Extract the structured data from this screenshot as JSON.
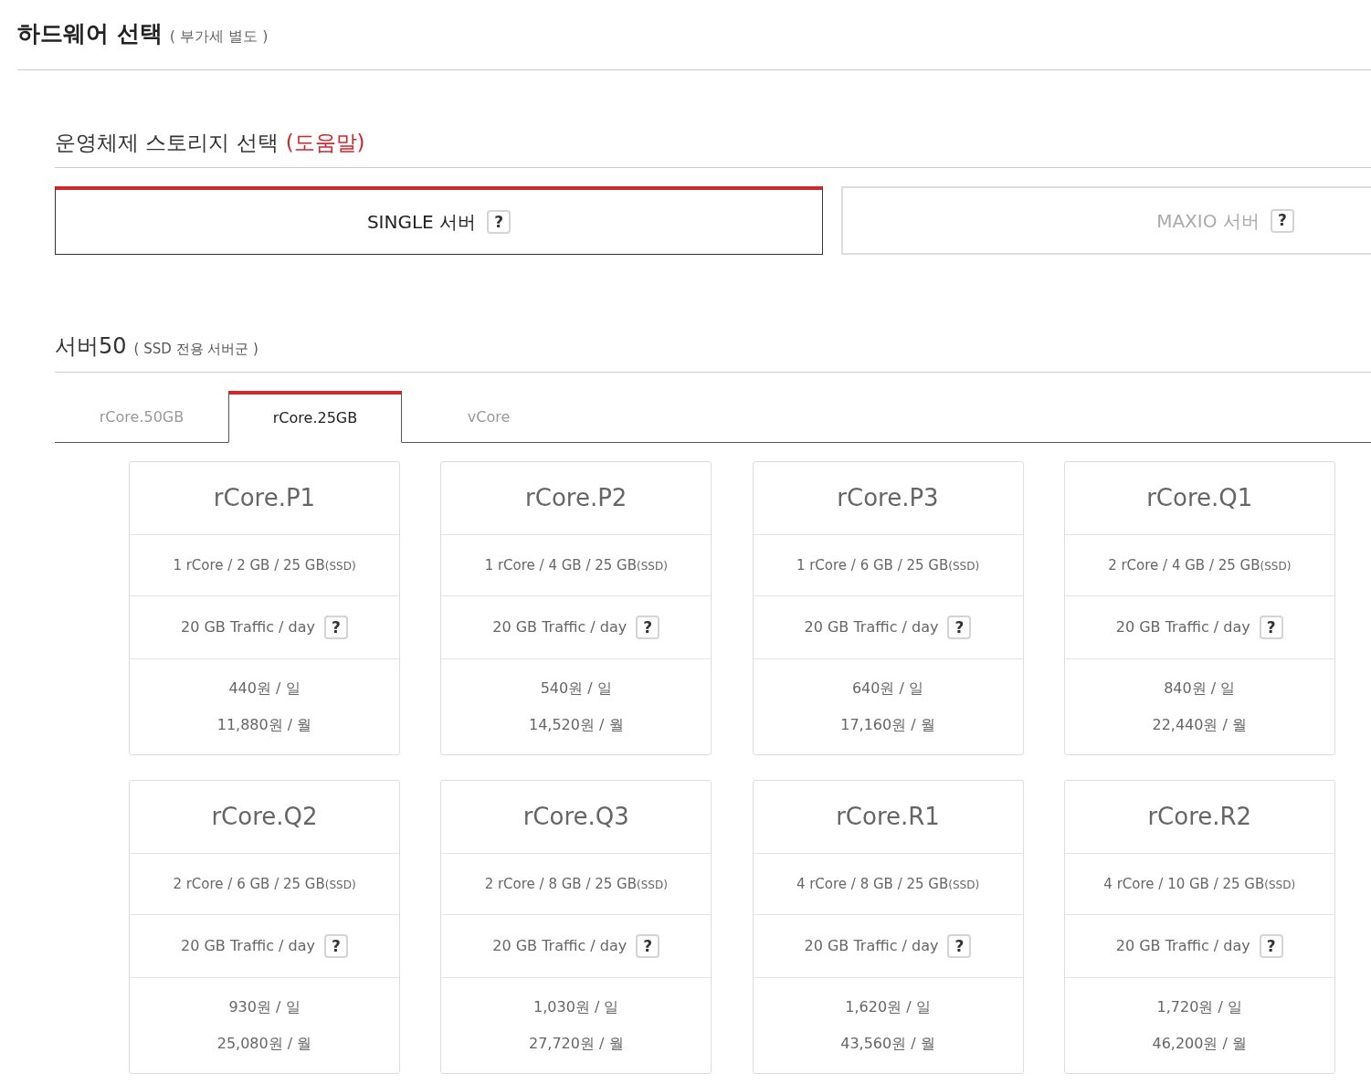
{
  "header": {
    "title": "하드웨어 선택",
    "note": "( 부가세 별도 )"
  },
  "os_section": {
    "title": "운영체제 스토리지 선택",
    "help_link": "(도움말)"
  },
  "server_types": [
    {
      "label": "SINGLE 서버",
      "help": "?",
      "selected": true
    },
    {
      "label": "MAXIO 서버",
      "help": "?",
      "selected": false
    }
  ],
  "group": {
    "title": "서버50",
    "note": "( SSD 전용 서버군 )"
  },
  "tabs": [
    {
      "label": "rCore.50GB",
      "selected": false
    },
    {
      "label": "rCore.25GB",
      "selected": true
    },
    {
      "label": "vCore",
      "selected": false
    }
  ],
  "plans": [
    {
      "name": "rCore.P1",
      "spec": "1 rCore / 2 GB / 25 GB",
      "spec_note": "(SSD)",
      "traffic": "20 GB Traffic / day",
      "help": "?",
      "daily": "440원 / 일",
      "monthly": "11,880원 / 월"
    },
    {
      "name": "rCore.P2",
      "spec": "1 rCore / 4 GB / 25 GB",
      "spec_note": "(SSD)",
      "traffic": "20 GB Traffic / day",
      "help": "?",
      "daily": "540원 / 일",
      "monthly": "14,520원 / 월"
    },
    {
      "name": "rCore.P3",
      "spec": "1 rCore / 6 GB / 25 GB",
      "spec_note": "(SSD)",
      "traffic": "20 GB Traffic / day",
      "help": "?",
      "daily": "640원 / 일",
      "monthly": "17,160원 / 월"
    },
    {
      "name": "rCore.Q1",
      "spec": "2 rCore / 4 GB / 25 GB",
      "spec_note": "(SSD)",
      "traffic": "20 GB Traffic / day",
      "help": "?",
      "daily": "840원 / 일",
      "monthly": "22,440원 / 월"
    },
    {
      "name": "rCore.Q2",
      "spec": "2 rCore / 6 GB / 25 GB",
      "spec_note": "(SSD)",
      "traffic": "20 GB Traffic / day",
      "help": "?",
      "daily": "930원 / 일",
      "monthly": "25,080원 / 월"
    },
    {
      "name": "rCore.Q3",
      "spec": "2 rCore / 8 GB / 25 GB",
      "spec_note": "(SSD)",
      "traffic": "20 GB Traffic / day",
      "help": "?",
      "daily": "1,030원 / 일",
      "monthly": "27,720원 / 월"
    },
    {
      "name": "rCore.R1",
      "spec": "4 rCore / 8 GB / 25 GB",
      "spec_note": "(SSD)",
      "traffic": "20 GB Traffic / day",
      "help": "?",
      "daily": "1,620원 / 일",
      "monthly": "43,560원 / 월"
    },
    {
      "name": "rCore.R2",
      "spec": "4 rCore / 10 GB / 25 GB",
      "spec_note": "(SSD)",
      "traffic": "20 GB Traffic / day",
      "help": "?",
      "daily": "1,720원 / 일",
      "monthly": "46,200원 / 월"
    }
  ]
}
